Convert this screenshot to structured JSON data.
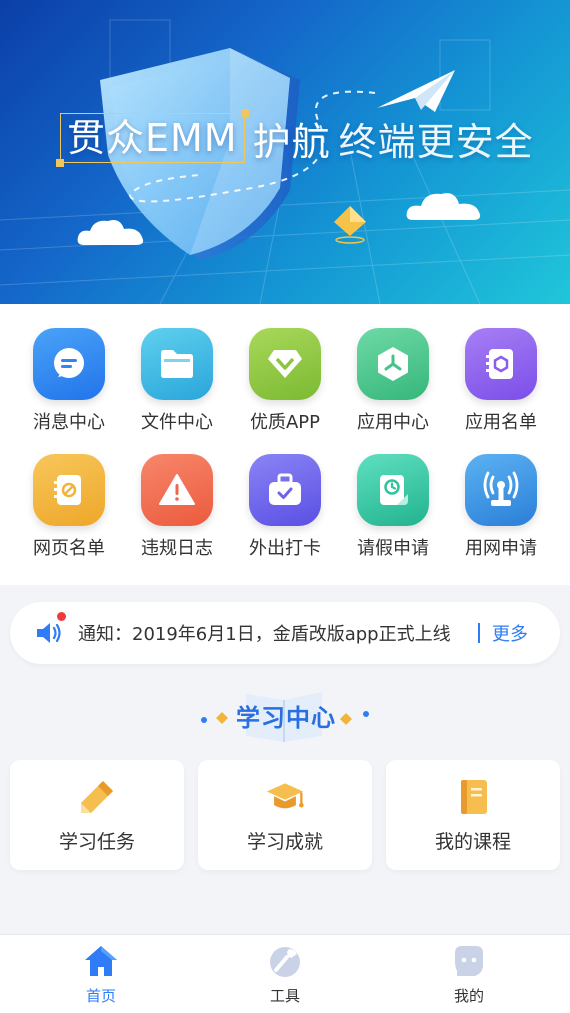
{
  "banner": {
    "brand": "贯众EMM",
    "word": "护航",
    "slogan": "终端更安全"
  },
  "grid": [
    {
      "label": "消息中心",
      "icon": "message-icon",
      "color": "#2f86f2"
    },
    {
      "label": "文件中心",
      "icon": "folder-icon",
      "color": "#2fb5e3"
    },
    {
      "label": "优质APP",
      "icon": "diamond-icon",
      "color": "#8cc53f"
    },
    {
      "label": "应用中心",
      "icon": "app-hub-icon",
      "color": "#45c38a"
    },
    {
      "label": "应用名单",
      "icon": "app-list-icon",
      "color": "#8b5cf0"
    },
    {
      "label": "网页名单",
      "icon": "web-list-icon",
      "color": "#f2b33a"
    },
    {
      "label": "违规日志",
      "icon": "warning-icon",
      "color": "#f0664a"
    },
    {
      "label": "外出打卡",
      "icon": "checkin-bag-icon",
      "color": "#6d63ec"
    },
    {
      "label": "请假申请",
      "icon": "leave-clock-icon",
      "color": "#2fc3a0"
    },
    {
      "label": "用网申请",
      "icon": "network-signal-icon",
      "color": "#2f95e0"
    }
  ],
  "notice": {
    "icon": "speaker-icon",
    "text": "通知：2019年6月1日，金盾改版app正式上线",
    "more": "更多"
  },
  "study": {
    "title": "学习中心",
    "cards": [
      {
        "label": "学习任务",
        "icon": "pencil-icon"
      },
      {
        "label": "学习成就",
        "icon": "graduation-cap-icon"
      },
      {
        "label": "我的课程",
        "icon": "book-icon"
      }
    ]
  },
  "tabs": [
    {
      "label": "首页",
      "icon": "home-icon",
      "active": true
    },
    {
      "label": "工具",
      "icon": "tools-icon",
      "active": false
    },
    {
      "label": "我的",
      "icon": "profile-icon",
      "active": false
    }
  ],
  "colors": {
    "accent": "#2f7cf6",
    "notice_dot": "#f03a3a",
    "icon_gold": "#f0b43a",
    "tab_inactive": "#c9d2e6"
  }
}
